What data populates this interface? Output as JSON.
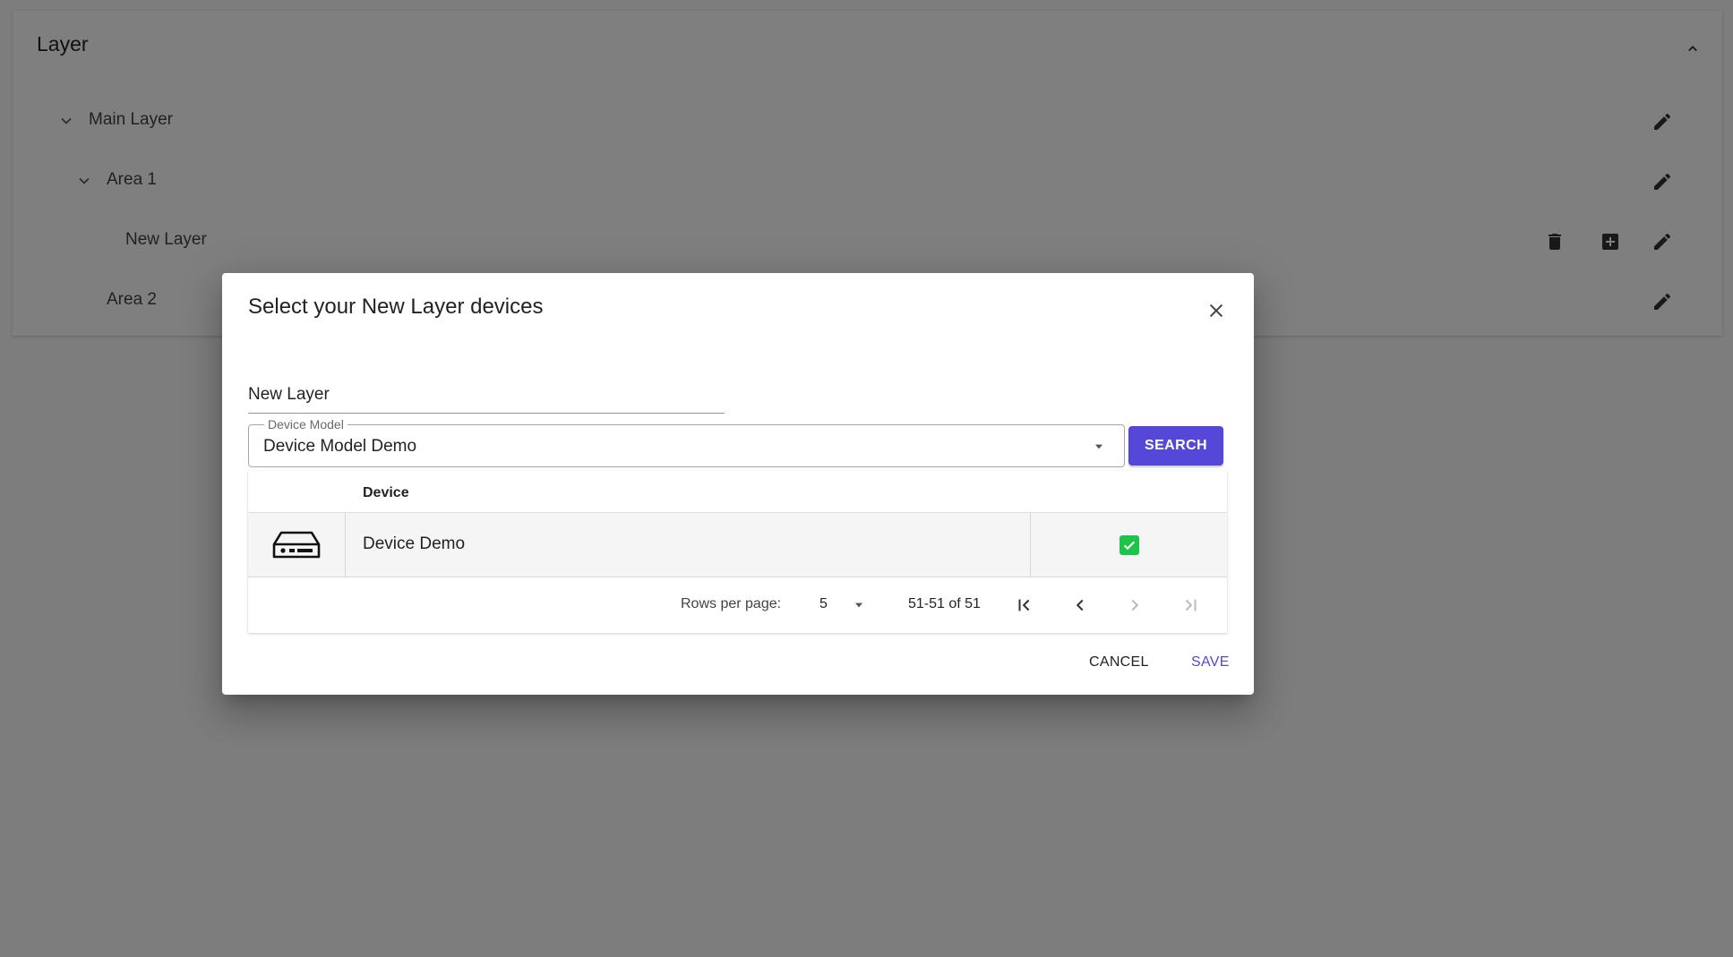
{
  "layer_panel": {
    "title": "Layer",
    "tree": [
      {
        "label": "Main Layer"
      },
      {
        "label": "Area 1"
      },
      {
        "label": "New Layer"
      },
      {
        "label": "Area 2"
      }
    ]
  },
  "dialog": {
    "title": "Select your New Layer devices",
    "layer_name_value": "New Layer",
    "device_model": {
      "label": "Device Model",
      "value": "Device Model Demo"
    },
    "search_label": "SEARCH",
    "table": {
      "columns": [
        "",
        "Device",
        ""
      ],
      "rows": [
        {
          "device": "Device Demo",
          "checked": true,
          "icon": "device-icon"
        }
      ]
    },
    "pagination": {
      "rows_per_page_label": "Rows per page:",
      "rows_per_page_value": "5",
      "range_text": "51-51 of 51"
    },
    "cancel_label": "CANCEL",
    "save_label": "SAVE"
  },
  "colors": {
    "accent": "#5548d9",
    "checkbox": "#1ec449",
    "backdrop": "rgba(0,0,0,0.5)"
  }
}
